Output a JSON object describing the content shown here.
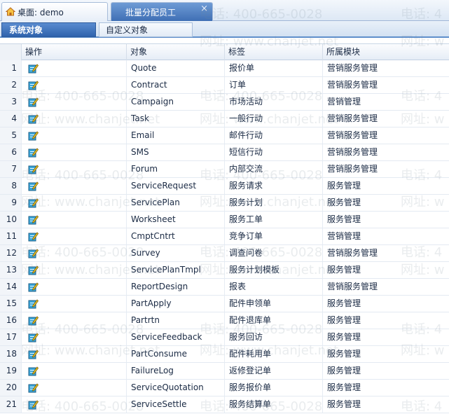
{
  "top_tabs": [
    {
      "label": "桌面: demo",
      "icon": "home-icon"
    },
    {
      "label": "批量分配员工",
      "close": "×"
    }
  ],
  "sub_tabs": [
    {
      "label": "系统对象",
      "active": true
    },
    {
      "label": "自定义对象",
      "active": false
    }
  ],
  "grid": {
    "columns": [
      "操作",
      "对象",
      "标签",
      "所属模块"
    ],
    "rows": [
      {
        "n": "1",
        "object": "Quote",
        "label": "报价单",
        "module": "营销服务管理"
      },
      {
        "n": "2",
        "object": "Contract",
        "label": "订单",
        "module": "营销服务管理"
      },
      {
        "n": "3",
        "object": "Campaign",
        "label": "市场活动",
        "module": "营销管理"
      },
      {
        "n": "4",
        "object": "Task",
        "label": "一般行动",
        "module": "营销服务管理"
      },
      {
        "n": "5",
        "object": "Email",
        "label": "邮件行动",
        "module": "营销服务管理"
      },
      {
        "n": "6",
        "object": "SMS",
        "label": "短信行动",
        "module": "营销服务管理"
      },
      {
        "n": "7",
        "object": "Forum",
        "label": "内部交流",
        "module": "营销服务管理"
      },
      {
        "n": "8",
        "object": "ServiceRequest",
        "label": "服务请求",
        "module": "服务管理"
      },
      {
        "n": "9",
        "object": "ServicePlan",
        "label": "服务计划",
        "module": "服务管理"
      },
      {
        "n": "10",
        "object": "Worksheet",
        "label": "服务工单",
        "module": "服务管理"
      },
      {
        "n": "11",
        "object": "CmptCntrt",
        "label": "竞争订单",
        "module": "营销管理"
      },
      {
        "n": "12",
        "object": "Survey",
        "label": "调查问卷",
        "module": "营销服务管理"
      },
      {
        "n": "13",
        "object": "ServicePlanTmpl",
        "label": "服务计划模板",
        "module": "服务管理"
      },
      {
        "n": "14",
        "object": "ReportDesign",
        "label": "报表",
        "module": "营销服务管理"
      },
      {
        "n": "15",
        "object": "PartApply",
        "label": "配件申领单",
        "module": "服务管理"
      },
      {
        "n": "16",
        "object": "Partrtn",
        "label": "配件退库单",
        "module": "服务管理"
      },
      {
        "n": "17",
        "object": "ServiceFeedback",
        "label": "服务回访",
        "module": "服务管理"
      },
      {
        "n": "18",
        "object": "PartConsume",
        "label": "配件耗用单",
        "module": "服务管理"
      },
      {
        "n": "19",
        "object": "FailureLog",
        "label": "返修登记单",
        "module": "服务管理"
      },
      {
        "n": "20",
        "object": "ServiceQuotation",
        "label": "服务报价单",
        "module": "服务管理"
      },
      {
        "n": "21",
        "object": "ServiceSettle",
        "label": "服务结算单",
        "module": "服务管理"
      }
    ]
  },
  "watermark": {
    "phone": "电话: 400-665-0028",
    "site": "网址: www.chanjet.net",
    "phone_short": "电话: 4",
    "site_short": "网址: w"
  }
}
